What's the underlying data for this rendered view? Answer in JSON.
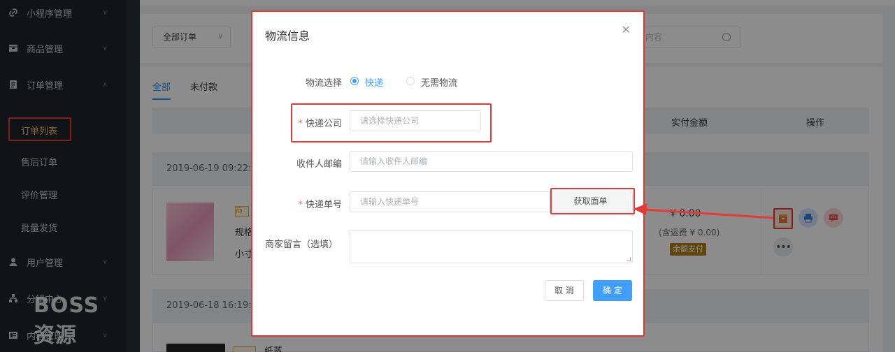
{
  "sidebar": {
    "items": [
      {
        "label": "小程序管理",
        "icon": "link-icon"
      },
      {
        "label": "商品管理",
        "icon": "box-icon"
      },
      {
        "label": "订单管理",
        "icon": "clipboard-icon"
      },
      {
        "label": "用户管理",
        "icon": "user-icon"
      },
      {
        "label": "分销中心",
        "icon": "network-icon"
      },
      {
        "label": "内容管理",
        "icon": "document-icon"
      }
    ],
    "sub_items": [
      "订单列表",
      "售后订单",
      "评价管理",
      "批量发货"
    ],
    "active_sub": "订单列表"
  },
  "watermark": "BOSS 资源",
  "filter": {
    "order_type": "全部订单",
    "search_placeholder": "内容"
  },
  "tabs": [
    "全部",
    "未付款"
  ],
  "table_headers": {
    "paid": "实付金额",
    "ops": "操作"
  },
  "orders": [
    {
      "time": "2019-06-19 09:22:0",
      "tag": "商",
      "name_prefix": "规格",
      "name_line2": "小寸",
      "price": "¥ 0.00",
      "shipping": "(含运费 ¥ 0.00)",
      "payment": "余额支付"
    },
    {
      "time": "2019-06-18 16:19:0",
      "name_prefix": "纸蒸"
    }
  ],
  "dialog": {
    "title": "物流信息",
    "logistics_label": "物流选择",
    "options": [
      "快递",
      "无需物流"
    ],
    "selected_option": "快递",
    "company_label": "快递公司",
    "company_placeholder": "请选择快递公司",
    "zip_label": "收件人邮编",
    "zip_placeholder": "请输入收件人邮编",
    "tracking_label": "快递单号",
    "tracking_placeholder": "请输入快递单号",
    "get_waybill": "获取面单",
    "remark_label": "商家留言（选填）",
    "cancel": "取 消",
    "confirm": "确 定"
  },
  "colors": {
    "accent": "#409eff",
    "highlight": "#e53935",
    "sidebar_bg": "#1f2329",
    "active_text": "#f0c24b"
  }
}
